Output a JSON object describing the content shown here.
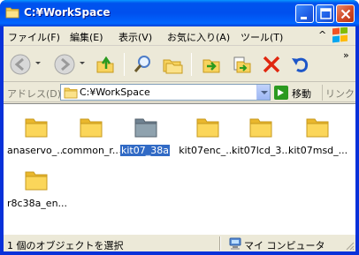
{
  "window": {
    "title": "C:¥WorkSpace",
    "colors": {
      "title_blue": "#0054e3",
      "close_red": "#d24a26",
      "selection": "#316ac5"
    }
  },
  "menubar": {
    "items": [
      "ファイル(F)",
      "編集(E)",
      "表示(V)",
      "お気に入り(A)",
      "ツール(T)"
    ],
    "overflow": "^"
  },
  "toolbar": {
    "overflow": "»",
    "icons": [
      "back-icon",
      "forward-icon",
      "up-folder-icon",
      "search-icon",
      "folders-icon",
      "move-to-icon",
      "copy-to-icon",
      "delete-icon",
      "undo-icon"
    ]
  },
  "address": {
    "label": "アドレス(D)",
    "value": "C:¥WorkSpace",
    "go": "移動",
    "links": "リンク"
  },
  "content": {
    "items": [
      {
        "label": "anaservo_...",
        "selected": false
      },
      {
        "label": "common_r...",
        "selected": false
      },
      {
        "label": "kit07_38a",
        "selected": true
      },
      {
        "label": "kit07enc_...",
        "selected": false
      },
      {
        "label": "kit07lcd_3...",
        "selected": false
      },
      {
        "label": "kit07msd_...",
        "selected": false
      },
      {
        "label": "r8c38a_en...",
        "selected": false
      }
    ]
  },
  "status": {
    "left": "1 個のオブジェクトを選択",
    "zone": "マイ コンピュータ"
  }
}
